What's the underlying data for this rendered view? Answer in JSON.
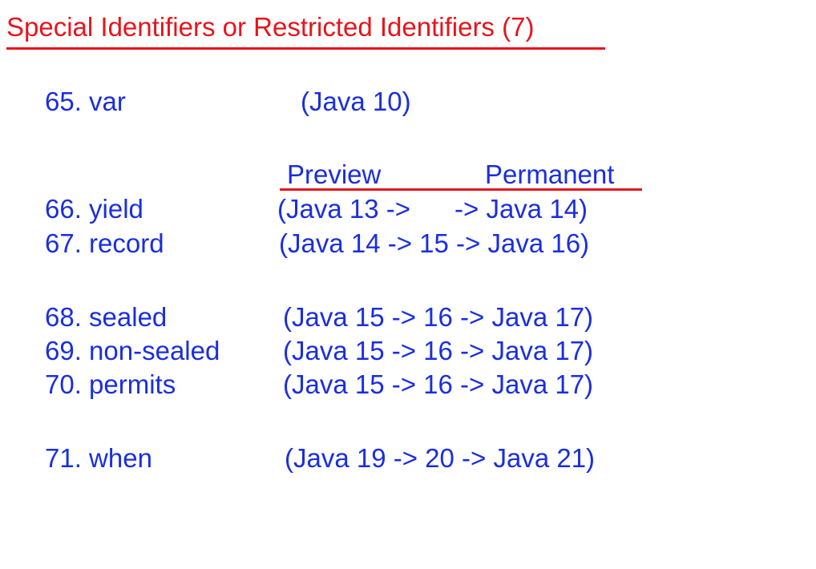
{
  "title": "Special Identifiers or Restricted Identifiers (7)",
  "columns": {
    "preview": "Preview",
    "permanent": "Permanent"
  },
  "items": [
    {
      "name": "65. var",
      "versions": "(Java 10)"
    },
    {
      "name": "66. yield",
      "versions": "(Java 13 ->      -> Java 14)"
    },
    {
      "name": "67. record",
      "versions": "(Java 14 -> 15 -> Java 16)"
    },
    {
      "name": "68. sealed",
      "versions": "(Java 15 -> 16 -> Java 17)"
    },
    {
      "name": "69. non-sealed",
      "versions": "(Java 15 -> 16 -> Java 17)"
    },
    {
      "name": "70. permits",
      "versions": "(Java 15 -> 16 -> Java 17)"
    },
    {
      "name": "71. when",
      "versions": "(Java 19 -> 20 -> Java 21)"
    }
  ],
  "colors": {
    "title": "#e8141b",
    "body": "#1a2ee0",
    "underline": "#e8141b"
  }
}
